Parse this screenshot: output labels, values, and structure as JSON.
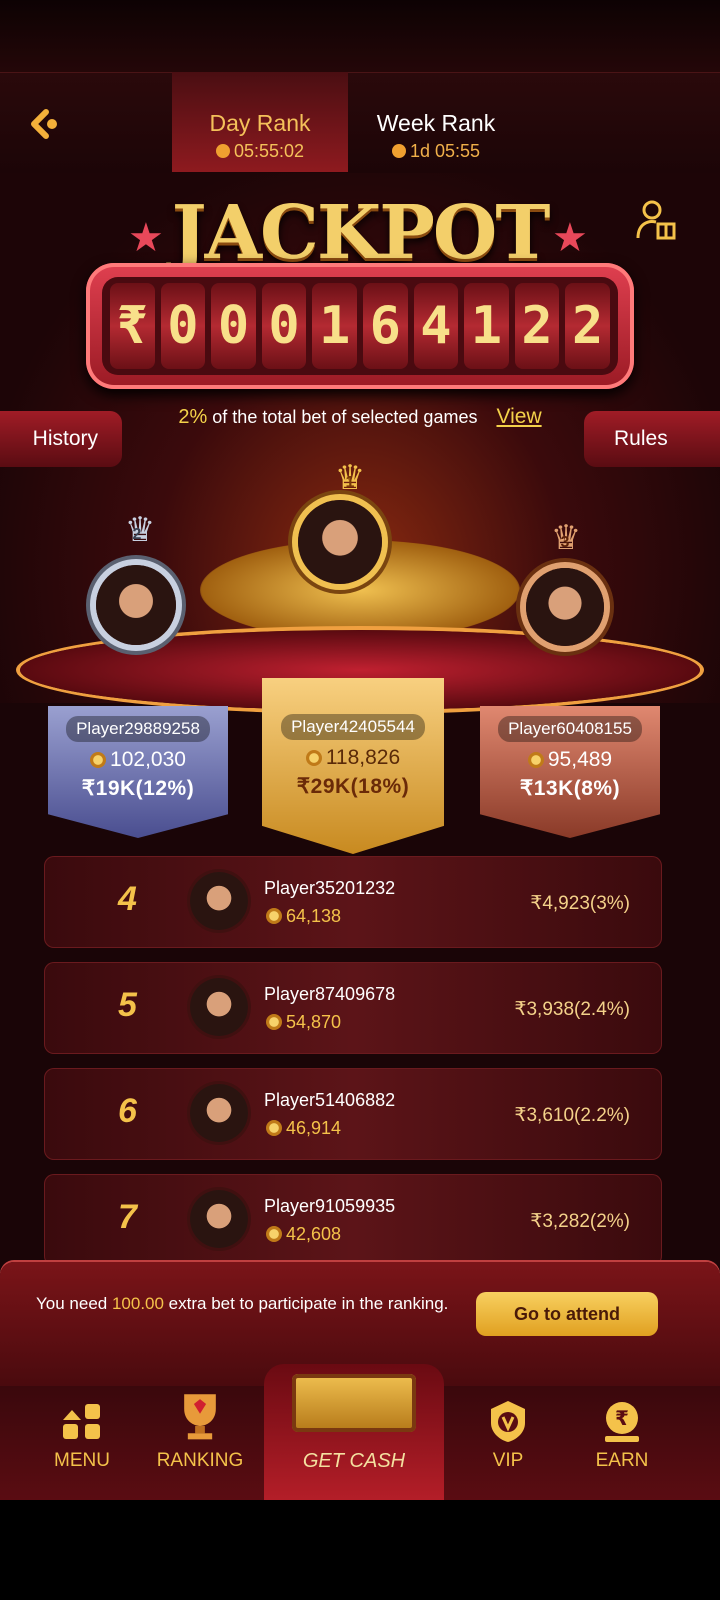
{
  "header": {
    "tabs": [
      {
        "label": "Day Rank",
        "timer": "05:55:02"
      },
      {
        "label": "Week Rank",
        "timer": "1d 05:55"
      }
    ]
  },
  "jackpot": {
    "title": "JACKPOT",
    "currency": "₹",
    "digits": [
      "0",
      "0",
      "0",
      "1",
      "6",
      "4",
      "1",
      "2",
      "2"
    ],
    "note_pct": "2%",
    "note_text": "of the total bet of selected games",
    "view_label": "View",
    "history_label": "History",
    "rules_label": "Rules"
  },
  "podium": [
    {
      "rank": "1",
      "name": "Player42405544",
      "coins": "118,826",
      "cash": "₹29K(18%)"
    },
    {
      "rank": "2",
      "name": "Player29889258",
      "coins": "102,030",
      "cash": "₹19K(12%)"
    },
    {
      "rank": "3",
      "name": "Player60408155",
      "coins": "95,489",
      "cash": "₹13K(8%)"
    }
  ],
  "rows": [
    {
      "rank": "4",
      "name": "Player35201232",
      "coins": "64,138",
      "reward": "₹4,923(3%)"
    },
    {
      "rank": "5",
      "name": "Player87409678",
      "coins": "54,870",
      "reward": "₹3,938(2.4%)"
    },
    {
      "rank": "6",
      "name": "Player51406882",
      "coins": "46,914",
      "reward": "₹3,610(2.2%)"
    },
    {
      "rank": "7",
      "name": "Player91059935",
      "coins": "42,608",
      "reward": "₹3,282(2%)"
    }
  ],
  "prompt": {
    "before": "You need ",
    "amount": "100.00",
    "after": " extra bet to participate in the ranking.",
    "button": "Go to attend"
  },
  "nav": [
    {
      "label": "MENU",
      "icon": "menu-grid-icon"
    },
    {
      "label": "RANKING",
      "icon": "trophy-icon"
    },
    {
      "label": "GET CASH",
      "icon": "treasure-chest-icon"
    },
    {
      "label": "VIP",
      "icon": "vip-shield-icon"
    },
    {
      "label": "EARN",
      "icon": "rupee-earn-icon"
    }
  ],
  "colors": {
    "accent": "#f4c24a",
    "primary": "#8e1a1f",
    "background": "#1a0507"
  }
}
